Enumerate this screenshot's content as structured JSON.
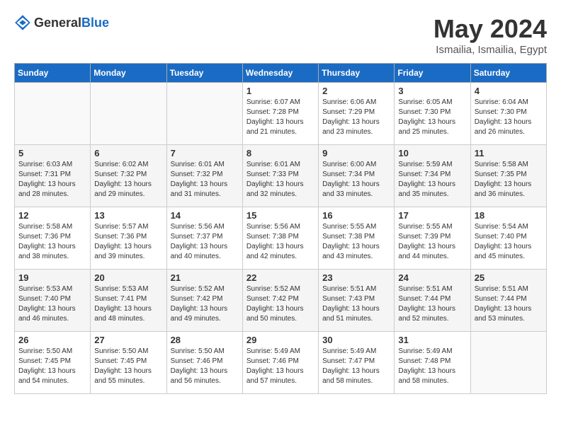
{
  "header": {
    "logo_general": "General",
    "logo_blue": "Blue",
    "month_title": "May 2024",
    "location": "Ismailia, Ismailia, Egypt"
  },
  "calendar": {
    "days_of_week": [
      "Sunday",
      "Monday",
      "Tuesday",
      "Wednesday",
      "Thursday",
      "Friday",
      "Saturday"
    ],
    "weeks": [
      [
        {
          "day": "",
          "content": ""
        },
        {
          "day": "",
          "content": ""
        },
        {
          "day": "",
          "content": ""
        },
        {
          "day": "1",
          "content": "Sunrise: 6:07 AM\nSunset: 7:28 PM\nDaylight: 13 hours\nand 21 minutes."
        },
        {
          "day": "2",
          "content": "Sunrise: 6:06 AM\nSunset: 7:29 PM\nDaylight: 13 hours\nand 23 minutes."
        },
        {
          "day": "3",
          "content": "Sunrise: 6:05 AM\nSunset: 7:30 PM\nDaylight: 13 hours\nand 25 minutes."
        },
        {
          "day": "4",
          "content": "Sunrise: 6:04 AM\nSunset: 7:30 PM\nDaylight: 13 hours\nand 26 minutes."
        }
      ],
      [
        {
          "day": "5",
          "content": "Sunrise: 6:03 AM\nSunset: 7:31 PM\nDaylight: 13 hours\nand 28 minutes."
        },
        {
          "day": "6",
          "content": "Sunrise: 6:02 AM\nSunset: 7:32 PM\nDaylight: 13 hours\nand 29 minutes."
        },
        {
          "day": "7",
          "content": "Sunrise: 6:01 AM\nSunset: 7:32 PM\nDaylight: 13 hours\nand 31 minutes."
        },
        {
          "day": "8",
          "content": "Sunrise: 6:01 AM\nSunset: 7:33 PM\nDaylight: 13 hours\nand 32 minutes."
        },
        {
          "day": "9",
          "content": "Sunrise: 6:00 AM\nSunset: 7:34 PM\nDaylight: 13 hours\nand 33 minutes."
        },
        {
          "day": "10",
          "content": "Sunrise: 5:59 AM\nSunset: 7:34 PM\nDaylight: 13 hours\nand 35 minutes."
        },
        {
          "day": "11",
          "content": "Sunrise: 5:58 AM\nSunset: 7:35 PM\nDaylight: 13 hours\nand 36 minutes."
        }
      ],
      [
        {
          "day": "12",
          "content": "Sunrise: 5:58 AM\nSunset: 7:36 PM\nDaylight: 13 hours\nand 38 minutes."
        },
        {
          "day": "13",
          "content": "Sunrise: 5:57 AM\nSunset: 7:36 PM\nDaylight: 13 hours\nand 39 minutes."
        },
        {
          "day": "14",
          "content": "Sunrise: 5:56 AM\nSunset: 7:37 PM\nDaylight: 13 hours\nand 40 minutes."
        },
        {
          "day": "15",
          "content": "Sunrise: 5:56 AM\nSunset: 7:38 PM\nDaylight: 13 hours\nand 42 minutes."
        },
        {
          "day": "16",
          "content": "Sunrise: 5:55 AM\nSunset: 7:38 PM\nDaylight: 13 hours\nand 43 minutes."
        },
        {
          "day": "17",
          "content": "Sunrise: 5:55 AM\nSunset: 7:39 PM\nDaylight: 13 hours\nand 44 minutes."
        },
        {
          "day": "18",
          "content": "Sunrise: 5:54 AM\nSunset: 7:40 PM\nDaylight: 13 hours\nand 45 minutes."
        }
      ],
      [
        {
          "day": "19",
          "content": "Sunrise: 5:53 AM\nSunset: 7:40 PM\nDaylight: 13 hours\nand 46 minutes."
        },
        {
          "day": "20",
          "content": "Sunrise: 5:53 AM\nSunset: 7:41 PM\nDaylight: 13 hours\nand 48 minutes."
        },
        {
          "day": "21",
          "content": "Sunrise: 5:52 AM\nSunset: 7:42 PM\nDaylight: 13 hours\nand 49 minutes."
        },
        {
          "day": "22",
          "content": "Sunrise: 5:52 AM\nSunset: 7:42 PM\nDaylight: 13 hours\nand 50 minutes."
        },
        {
          "day": "23",
          "content": "Sunrise: 5:51 AM\nSunset: 7:43 PM\nDaylight: 13 hours\nand 51 minutes."
        },
        {
          "day": "24",
          "content": "Sunrise: 5:51 AM\nSunset: 7:44 PM\nDaylight: 13 hours\nand 52 minutes."
        },
        {
          "day": "25",
          "content": "Sunrise: 5:51 AM\nSunset: 7:44 PM\nDaylight: 13 hours\nand 53 minutes."
        }
      ],
      [
        {
          "day": "26",
          "content": "Sunrise: 5:50 AM\nSunset: 7:45 PM\nDaylight: 13 hours\nand 54 minutes."
        },
        {
          "day": "27",
          "content": "Sunrise: 5:50 AM\nSunset: 7:45 PM\nDaylight: 13 hours\nand 55 minutes."
        },
        {
          "day": "28",
          "content": "Sunrise: 5:50 AM\nSunset: 7:46 PM\nDaylight: 13 hours\nand 56 minutes."
        },
        {
          "day": "29",
          "content": "Sunrise: 5:49 AM\nSunset: 7:46 PM\nDaylight: 13 hours\nand 57 minutes."
        },
        {
          "day": "30",
          "content": "Sunrise: 5:49 AM\nSunset: 7:47 PM\nDaylight: 13 hours\nand 58 minutes."
        },
        {
          "day": "31",
          "content": "Sunrise: 5:49 AM\nSunset: 7:48 PM\nDaylight: 13 hours\nand 58 minutes."
        },
        {
          "day": "",
          "content": ""
        }
      ]
    ]
  }
}
